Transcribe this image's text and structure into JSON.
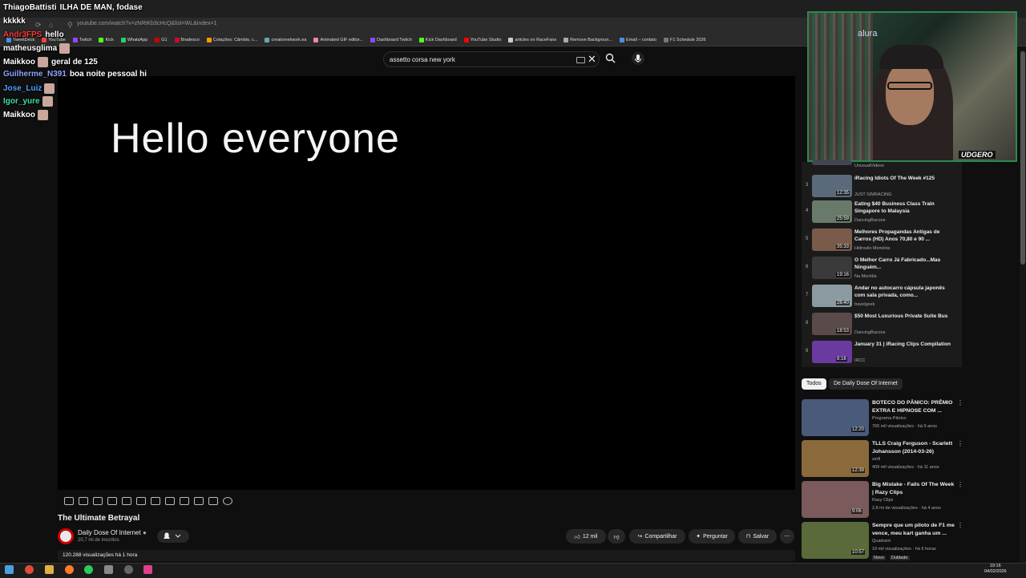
{
  "browser": {
    "url": "youtube.com/watch?v=zNRtKb3cHcQ&list=WL&index=1",
    "bookmarks": [
      "TweetDeck",
      "YouTube",
      "Twitch",
      "Kick",
      "WhatsApp",
      "G1",
      "Bradesco",
      "Cotações: Câmbio, c...",
      "creatornetwork.ea",
      "Animated GIF editor...",
      "Dashboard Twitch",
      "Kick Dashboard",
      "YouTube Studio",
      "articles on RaceFans",
      "Remove Backgroun...",
      "Email – contato",
      "F1 Schedule 2026"
    ]
  },
  "search": {
    "query": "assetto corsa new york"
  },
  "chat": [
    {
      "user": "ThiagoBattisti",
      "msg": "ILHA DE MAN, fodase",
      "color": "#ffffff"
    },
    {
      "user": "kkkkk",
      "msg": "",
      "color": "#ffffff"
    },
    {
      "user": "Andr3FPS",
      "msg": "hello",
      "color": "#ff3b3b"
    },
    {
      "user": "matheusglima",
      "msg": "",
      "color": "#ffffff"
    },
    {
      "user": "Maikkoo",
      "msg": "geral de 125",
      "color": "#ffffff"
    },
    {
      "user": "Guilherme_N391",
      "msg": "boa noite pessoal hi",
      "color": "#8fa3ff"
    },
    {
      "user": "Jose_Luiz",
      "msg": "",
      "color": "#4fa0ff"
    },
    {
      "user": "Igor_yure",
      "msg": "",
      "color": "#3fe0a0"
    },
    {
      "user": "Maikkoo",
      "msg": "",
      "color": "#ffffff"
    }
  ],
  "player": {
    "caption": "Hello everyone"
  },
  "video": {
    "title": "The Ultimate Betrayal",
    "channel": "Daily Dose Of Internet",
    "subscribers": "20,7 mi de inscritos",
    "likes": "12 mil",
    "share": "Compartilhar",
    "ask": "Perguntar",
    "save": "Salvar",
    "views": "120.288 visualizações  há 1 hora"
  },
  "webcam": {
    "brand": "UDGERO",
    "shirt_text": "alura"
  },
  "playlist": [
    {
      "num": "",
      "title": "",
      "channel": "UnusualVideos",
      "duration": "",
      "color": "#445"
    },
    {
      "num": "3",
      "title": "iRacing Idiots Of The Week #125",
      "channel": "JUST SIMRACING",
      "duration": "12:35",
      "color": "#5a6a7a"
    },
    {
      "num": "4",
      "title": "Eating $40 Business Class Train Singapore to Malaysia",
      "channel": "DancingBacons",
      "duration": "25:59",
      "color": "#6a7a6a"
    },
    {
      "num": "5",
      "title": "Melhores Propagandas Antigas de Carros (HD) Anos 70,80 e 90 ...",
      "channel": "Hidrosilo Memória",
      "duration": "35:33",
      "color": "#7a5a4a"
    },
    {
      "num": "6",
      "title": "O Melhor Carro Já Fabricado...Mas Ninguém...",
      "channel": "Na Mochila",
      "duration": "19:16",
      "color": "#3a3a3a"
    },
    {
      "num": "7",
      "title": "Andar no autocarro cápsula japonês com sala privada, como...",
      "channel": "travelgeek",
      "duration": "28:40",
      "color": "#8a9aa0"
    },
    {
      "num": "8",
      "title": "$50 Most Luxurious Private Suite Bus",
      "channel": "DancingBacons",
      "duration": "18:53",
      "color": "#5a4a4a"
    },
    {
      "num": "9",
      "title": "January 31 | iRacing Clips Compilation",
      "channel": "IRCC",
      "duration": "8:16",
      "color": "#6a3aa0"
    }
  ],
  "chips": {
    "all": "Todos",
    "channel": "De Daily Dose Of Internet"
  },
  "recommended": [
    {
      "title": "BOTECO DO PÂNICO: PRÊMIO EXTRA E HIPNOSE COM ...",
      "channel": "Programa Pânico",
      "meta": "700 mil visualizações · há 9 anos",
      "duration": "12:20",
      "color": "#4a5a7a"
    },
    {
      "title": "TLLS Craig Ferguson - Scarlett Johansson (2014-03-26)",
      "channel": "zerfi",
      "meta": "409 mil visualizações · há 11 anos",
      "duration": "12:39",
      "color": "#8a6a3a"
    },
    {
      "title": "Big Mistake - Fails Of The Week | Razy Clips",
      "channel": "Razy Clips",
      "meta": "2,8 mi de visualizações · há 4 anos",
      "duration": "9:06",
      "color": "#7a5a5a"
    },
    {
      "title": "Sempre que um piloto de F1 me vence, meu kart ganha um ...",
      "channel": "Quadrant",
      "meta": "19 mil visualizações · há 6 horas",
      "duration": "10:57",
      "color": "#5a6a3a"
    }
  ],
  "dubbed": "Dublado",
  "new_badge": "Novo",
  "clock": {
    "time": "19:16",
    "date": "04/02/2026"
  }
}
